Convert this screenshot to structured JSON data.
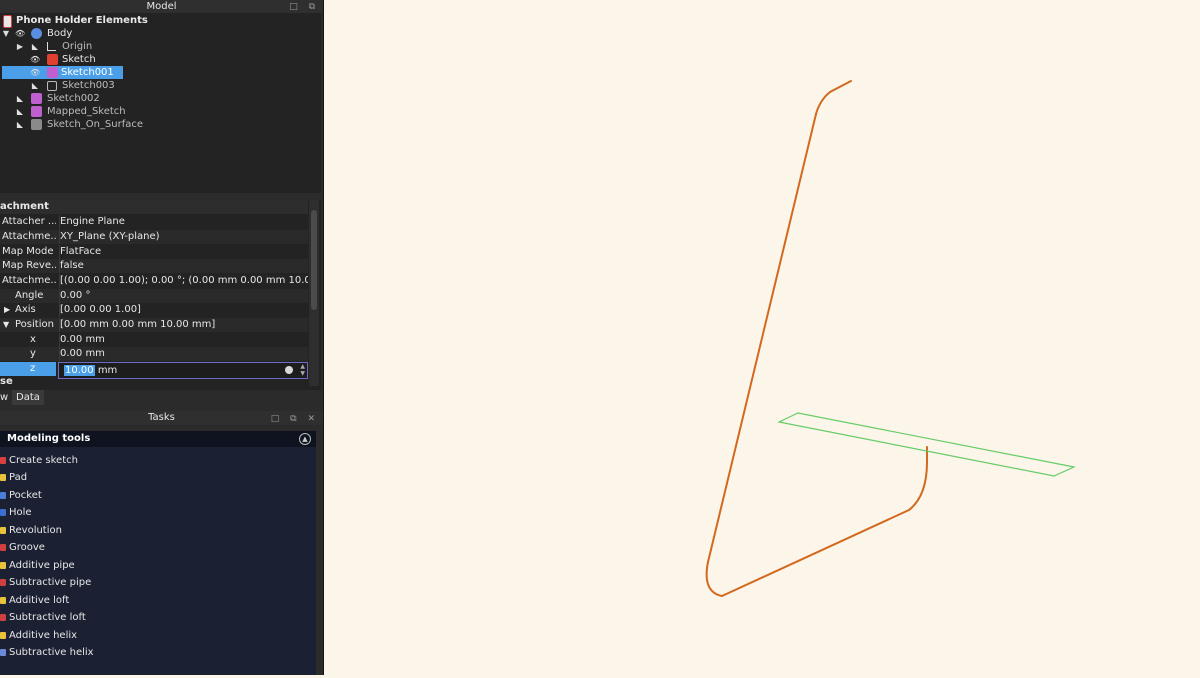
{
  "model_panel": {
    "title": "Model",
    "tree": [
      {
        "label": "Phone Holder Elements",
        "bold": true
      },
      {
        "label": "Body"
      },
      {
        "label": "Origin"
      },
      {
        "label": "Sketch"
      },
      {
        "label": "Sketch001",
        "selected": true
      },
      {
        "label": "Sketch003"
      },
      {
        "label": "Sketch002"
      },
      {
        "label": "Mapped_Sketch"
      },
      {
        "label": "Sketch_On_Surface"
      }
    ]
  },
  "properties": {
    "group": "achment",
    "rows": [
      {
        "name": "Attacher ...",
        "value": "Engine Plane"
      },
      {
        "name": "Attachme...",
        "value": "XY_Plane (XY-plane)"
      },
      {
        "name": "Map Mode",
        "value": "FlatFace"
      },
      {
        "name": "Map Reve...",
        "value": "false"
      },
      {
        "name": "Attachme...",
        "value": "[(0.00 0.00 1.00); 0.00 °; (0.00 mm  0.00 mm  10.00 ..."
      },
      {
        "name": "Angle",
        "value": "0.00 °"
      },
      {
        "name": "Axis",
        "value": "[0.00 0.00 1.00]"
      },
      {
        "name": "Position",
        "value": "[0.00 mm  0.00 mm  10.00 mm]"
      },
      {
        "name": "x",
        "value": "0.00 mm"
      },
      {
        "name": "y",
        "value": "0.00 mm"
      },
      {
        "name": "z"
      }
    ],
    "z_editor": {
      "selected_text": "10.00",
      "unit": " mm"
    },
    "next_group": "se",
    "tabs": [
      "w",
      "Data"
    ]
  },
  "tasks_panel": {
    "title": "Tasks",
    "section": "Modeling tools",
    "items": [
      {
        "label": "Create sketch",
        "color": "#d84040"
      },
      {
        "label": "Pad",
        "color": "#e8c23a"
      },
      {
        "label": "Pocket",
        "color": "#4a7fd8"
      },
      {
        "label": "Hole",
        "color": "#3a6fd0"
      },
      {
        "label": "Revolution",
        "color": "#e8c23a"
      },
      {
        "label": "Groove",
        "color": "#d04040"
      },
      {
        "label": "Additive pipe",
        "color": "#e8c23a"
      },
      {
        "label": "Subtractive pipe",
        "color": "#d04040"
      },
      {
        "label": "Additive loft",
        "color": "#e8c23a"
      },
      {
        "label": "Subtractive loft",
        "color": "#d04040"
      },
      {
        "label": "Additive helix",
        "color": "#e8c23a"
      },
      {
        "label": "Subtractive helix",
        "color": "#6a8ad8"
      }
    ]
  },
  "viewport": {
    "background": "#fcf5ea",
    "profile_color": "#d2691e",
    "plane_color": "#66cc66"
  }
}
